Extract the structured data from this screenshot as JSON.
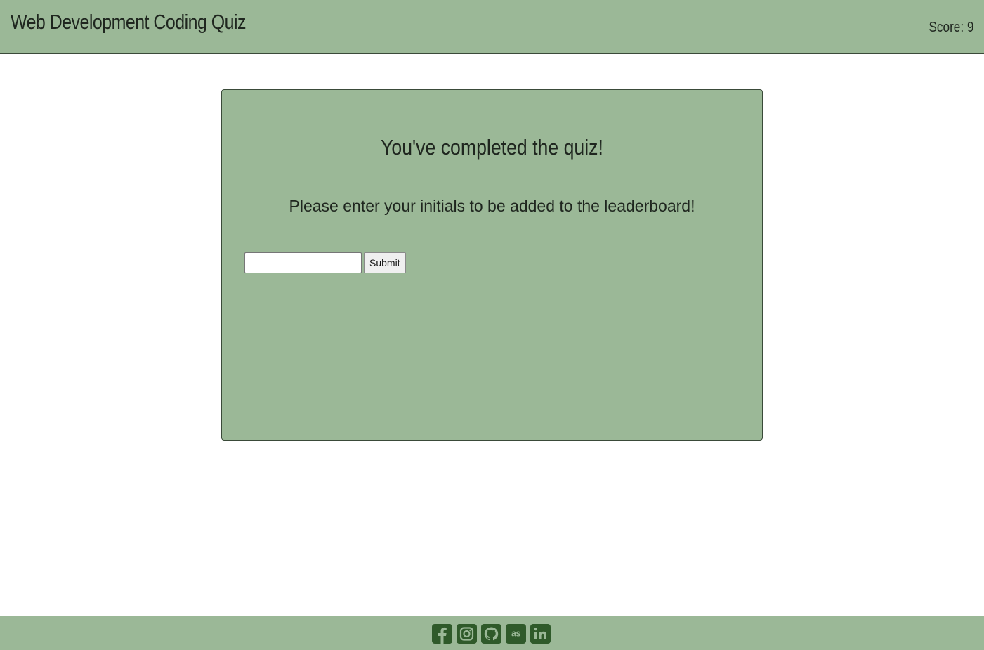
{
  "header": {
    "title": "Web Development Coding Quiz",
    "score_label": "Score: 9"
  },
  "card": {
    "heading": "You've completed the quiz!",
    "message": "Please enter your initials to be added to the leaderboard!",
    "input_value": "",
    "submit_label": "Submit"
  },
  "footer": {
    "icons": [
      "facebook-icon",
      "instagram-icon",
      "github-icon",
      "lastfm-icon",
      "linkedin-icon"
    ]
  },
  "colors": {
    "panel": "#9bb897",
    "icon": "#2f5a2a",
    "text": "#1f261f"
  }
}
